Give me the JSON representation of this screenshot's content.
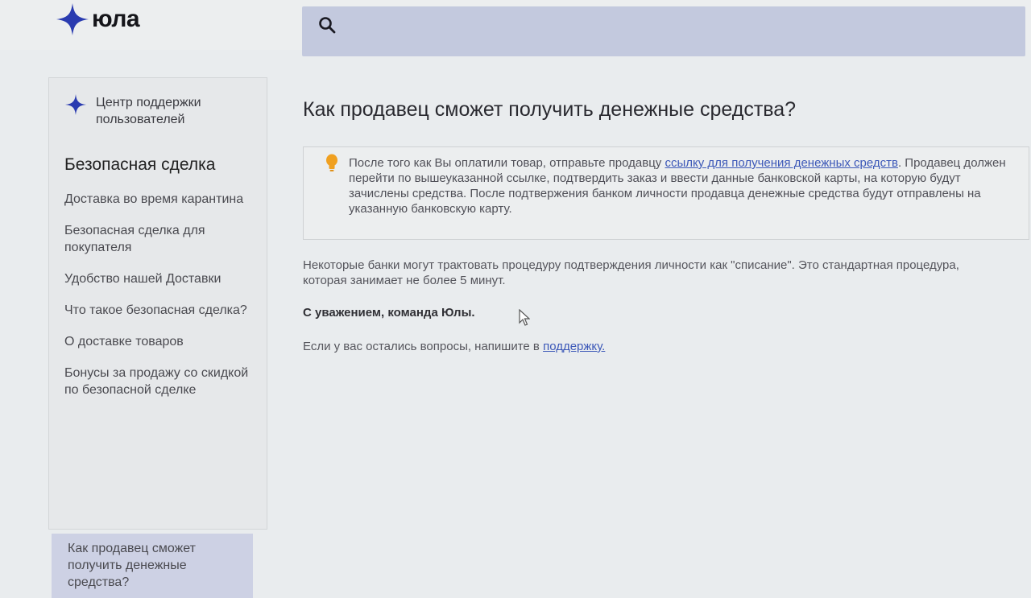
{
  "header": {
    "logo_text": "юла",
    "search_placeholder": ""
  },
  "sidebar": {
    "support_label": "Центр поддержки пользователей",
    "section_title": "Безопасная сделка",
    "items": [
      {
        "label": "Доставка во время карантина"
      },
      {
        "label": "Безопасная сделка для покупателя"
      },
      {
        "label": "Удобство нашей Доставки"
      },
      {
        "label": "Что такое безопасная сделка?"
      },
      {
        "label": "О доставке товаров"
      },
      {
        "label": "Бонусы за продажу со скидкой по безопасной сделке"
      },
      {
        "label": "Как продавец сможет получить денежные средства?"
      }
    ],
    "active_index": 6
  },
  "main": {
    "title": "Как продавец сможет получить денежные средства?",
    "info": {
      "text_before_link": "После того как Вы оплатили товар, отправьте продавцу ",
      "link_text": "ссылку для получения денежных средств",
      "text_after_link": ". Продавец должен перейти по вышеуказанной ссылке, подтвердить заказ и ввести данные банковской карты, на которую будут зачислены средства. После подтвержения банком личности продавца денежные средства будут отправлены на указанную банковскую карту."
    },
    "note": "Некоторые банки могут трактовать процедуру подтверждения личности как \"списание\". Это стандартная процедура, которая занимает не более 5 минут.",
    "regards": "С уважением, команда Юлы.",
    "contact_prefix": "Если у вас остались вопросы, напишите в ",
    "contact_link": "поддержку."
  },
  "colors": {
    "brand_star": "#2a3bb0",
    "link": "#3c58b8",
    "search_bg": "#c3c9de",
    "active_item_bg": "#cdd1e4",
    "bulb": "#f0a020"
  },
  "icons": [
    "logo-star-icon",
    "search-icon",
    "support-star-icon",
    "lightbulb-icon",
    "cursor-icon"
  ]
}
